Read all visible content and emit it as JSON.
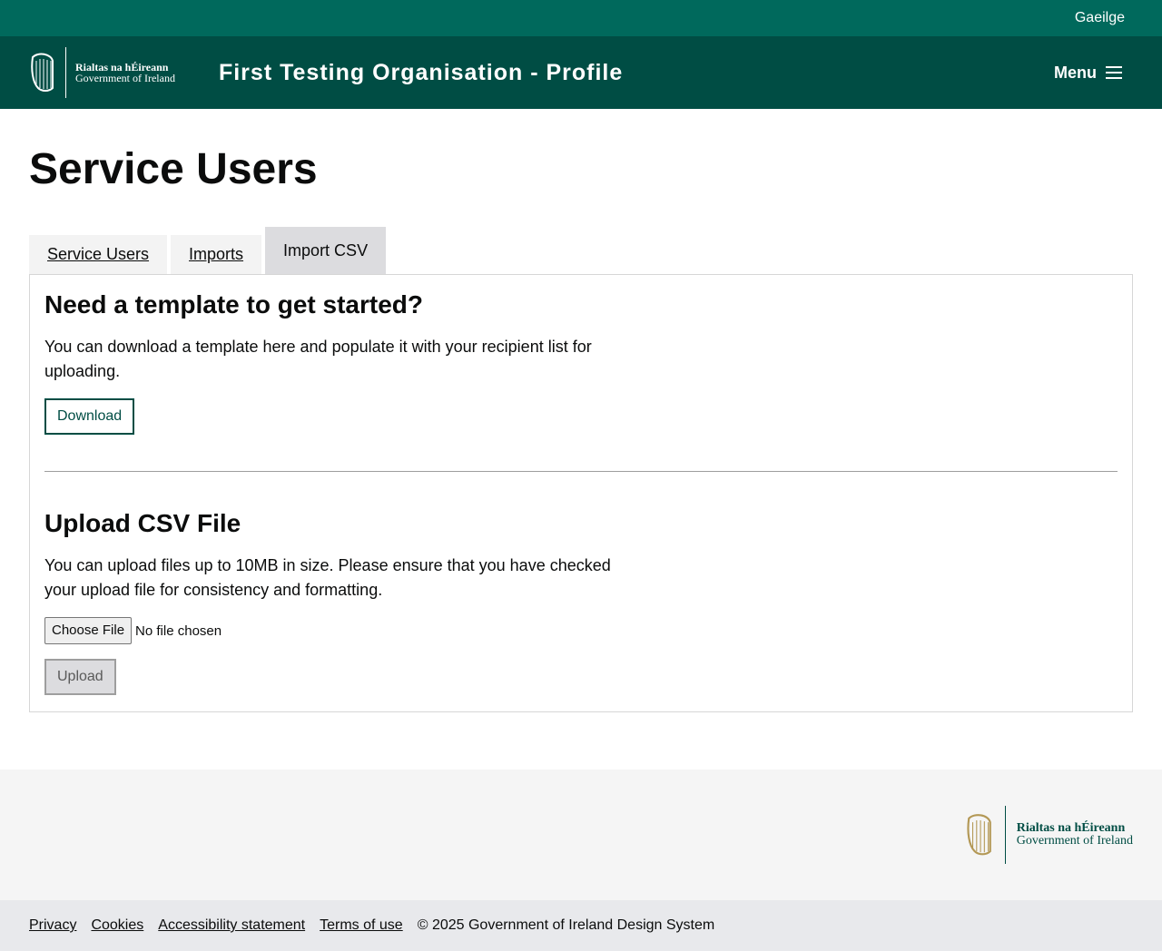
{
  "topbar": {
    "language_link": "Gaeilge"
  },
  "header": {
    "logo_line1": "Rialtas na hÉireann",
    "logo_line2": "Government of Ireland",
    "title": "First Testing Organisation - Profile",
    "menu_label": "Menu",
    "menu_icon": "hamburger-icon"
  },
  "main": {
    "page_title": "Service Users",
    "tabs": [
      {
        "label": "Service Users",
        "active": false
      },
      {
        "label": "Imports",
        "active": false
      },
      {
        "label": "Import CSV",
        "active": true
      }
    ],
    "template_section": {
      "heading": "Need a template to get started?",
      "body": "You can download a template here and populate it with your recipient list for uploading.",
      "button": "Download"
    },
    "upload_section": {
      "heading": "Upload CSV File",
      "body": "You can upload files up to 10MB in size. Please ensure that you have checked your upload file for consistency and formatting.",
      "file_button": "Choose File",
      "file_status": "No file chosen",
      "upload_button": "Upload"
    }
  },
  "footer": {
    "logo_line1": "Rialtas na hÉireann",
    "logo_line2": "Government of Ireland",
    "links": [
      "Privacy",
      "Cookies",
      "Accessibility statement",
      "Terms of use"
    ],
    "copyright": "© 2025 Government of Ireland Design System"
  },
  "colors": {
    "topbar": "#00695c",
    "header": "#004d44",
    "harp_gold": "#b39855"
  }
}
